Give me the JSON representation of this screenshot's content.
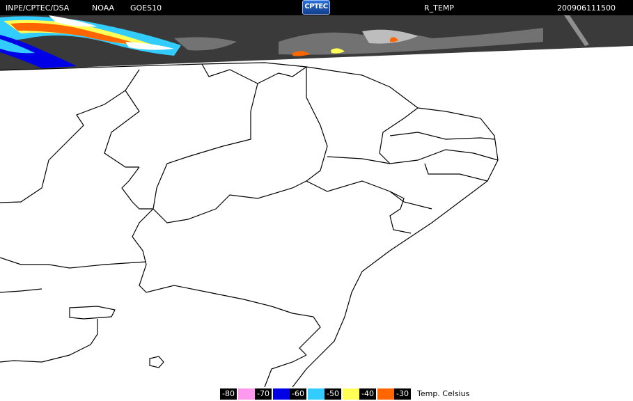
{
  "header": {
    "org": "INPE/CPTEC/DSA",
    "agency": "NOAA",
    "satellite": "GOES10",
    "logo_text": "CPTEC",
    "product": "R_TEMP",
    "timestamp": "200906111500"
  },
  "legend": {
    "title": "Temp. Celsius",
    "items": [
      {
        "label": "-80",
        "color": "#ff99ee"
      },
      {
        "label": "-70",
        "color": "#0000e6"
      },
      {
        "label": "-60",
        "color": "#33ccff"
      },
      {
        "label": "-50",
        "color": "#ffff55"
      },
      {
        "label": "-40",
        "color": "#ff6600"
      },
      {
        "label": "-30",
        "color": null
      }
    ]
  },
  "colors": {
    "background": "#ffffff",
    "cloud_top_base": "#3a3a3a",
    "boundaries": "#000000"
  }
}
